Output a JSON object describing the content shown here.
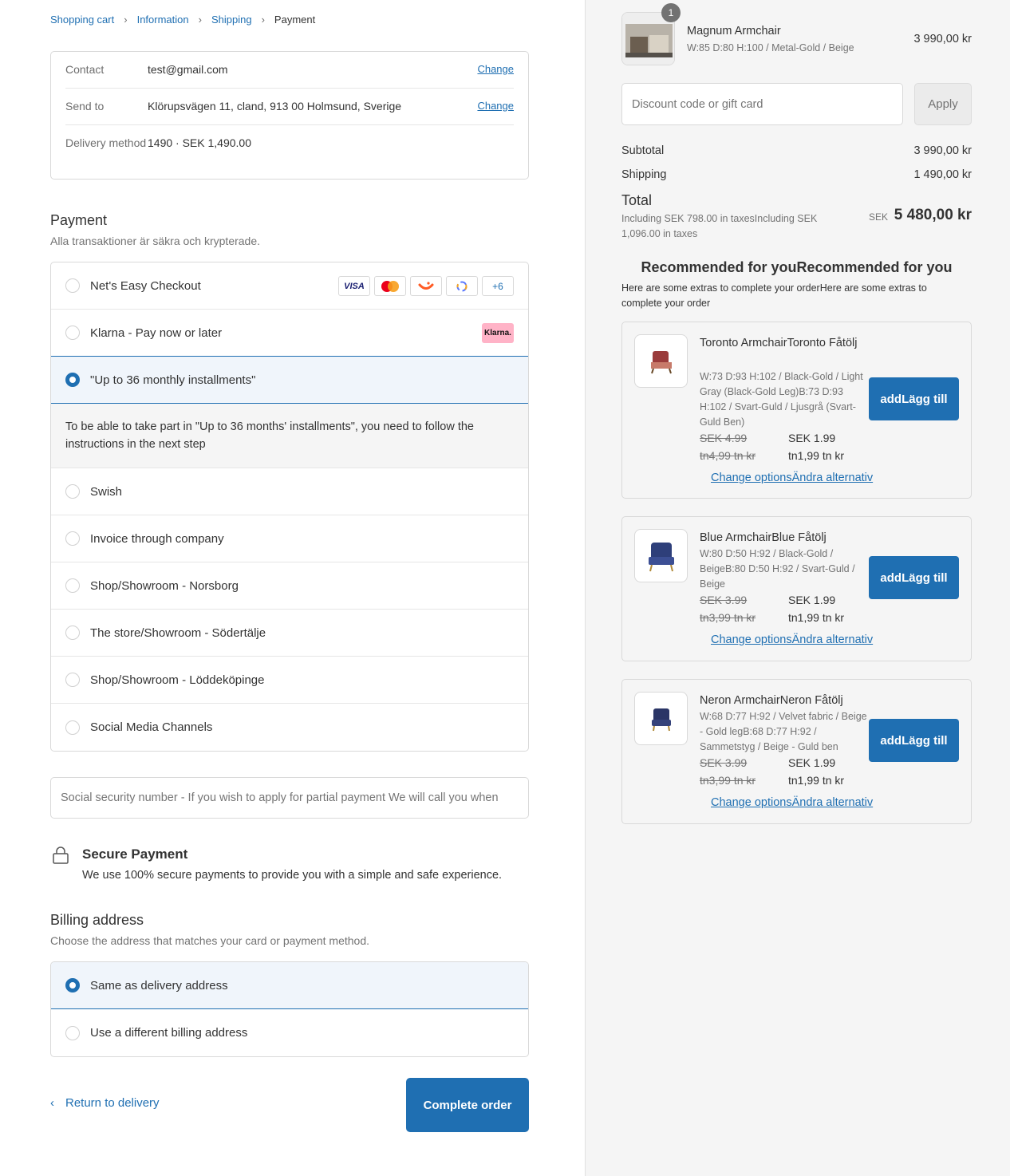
{
  "breadcrumb": {
    "cart": "Shopping cart",
    "information": "Information",
    "shipping": "Shipping",
    "payment": "Payment",
    "separator": "›"
  },
  "summary": {
    "contact_label": "Contact",
    "contact_value": "test@gmail.com",
    "sendto_label": "Send to",
    "sendto_value": "Klörupsvägen 11, cland, 913 00 Holmsund, Sverige",
    "delivery_label": "Delivery method",
    "delivery_value": "1490 · SEK 1,490.00",
    "change_label": "Change"
  },
  "payment": {
    "title": "Payment",
    "subtitle": "Alla transaktioner är säkra och krypterade.",
    "options": [
      "Net's Easy Checkout",
      "Klarna - Pay now or later",
      "\"Up to 36 monthly installments\"",
      "Swish",
      "Invoice through company",
      "Shop/Showroom - Norsborg",
      "The store/Showroom - Södertälje",
      "Shop/Showroom - Löddeköpinge",
      "Social Media Channels"
    ],
    "selected_index": 2,
    "installment_info": "To be able to take part in \"Up to 36 months' installments\", you need to follow the instructions in the next step",
    "cards": {
      "visa": "VISA",
      "more": "+6"
    },
    "klarna_badge": "Klarna."
  },
  "ssn": {
    "placeholder": "Social security number - If you wish to apply for partial payment We will call you when"
  },
  "secure": {
    "title": "Secure Payment",
    "text": "We use 100% secure payments to provide you with a simple and safe experience."
  },
  "billing": {
    "title": "Billing address",
    "subtitle": "Choose the address that matches your card or payment method.",
    "options": [
      "Same as delivery address",
      "Use a different billing address"
    ],
    "selected_index": 0
  },
  "footer": {
    "return_label": "Return to delivery",
    "complete_label": "Complete order"
  },
  "order": {
    "quantity": "1",
    "name": "Magnum Armchair",
    "variant": "W:85 D:80 H:100 / Metal-Gold / Beige",
    "price": "3 990,00 kr"
  },
  "discount": {
    "placeholder": "Discount code or gift card",
    "apply_label": "Apply"
  },
  "totals": {
    "subtotal_label": "Subtotal",
    "subtotal_value": "3 990,00 kr",
    "shipping_label": "Shipping",
    "shipping_value": "1 490,00 kr",
    "total_label": "Total",
    "tax_note": "Including SEK 798.00 in taxesIncluding SEK 1,096.00 in taxes",
    "currency": "SEK",
    "total_value": "5 480,00 kr"
  },
  "recommended": {
    "title": "Recommended for youRecommended for you",
    "subtitle": "Here are some extras to complete your orderHere are some extras to complete your order",
    "items": [
      {
        "name": "Toronto ArmchairToronto Fåtölj",
        "variant": "W:73 D:93 H:102 / Black-Gold / Light Gray (Black-Gold Leg)B:73 D:93 H:102 / Svart-Guld / Ljusgrå (Svart-Guld Ben)",
        "old_price": "SEK 4.99",
        "new_price": "SEK 1.99",
        "old_price2": "tn4,99 tn kr",
        "new_price2": "tn1,99 tn kr",
        "link": "Change optionsÄndra alternativ",
        "button": "addLägg till"
      },
      {
        "name": "Blue ArmchairBlue Fåtölj",
        "variant": "W:80 D:50 H:92 / Black-Gold / BeigeB:80 D:50 H:92 / Svart-Guld / Beige",
        "old_price": "SEK 3.99",
        "new_price": "SEK 1.99",
        "old_price2": "tn3,99 tn kr",
        "new_price2": "tn1,99 tn kr",
        "link": "Change optionsÄndra alternativ",
        "button": "addLägg till"
      },
      {
        "name": "Neron ArmchairNeron Fåtölj",
        "variant": "W:68 D:77 H:92 / Velvet fabric / Beige - Gold legB:68 D:77 H:92 / Sammetstyg / Beige - Guld ben",
        "old_price": "SEK 3.99",
        "new_price": "SEK 1.99",
        "old_price2": "tn3,99 tn kr",
        "new_price2": "tn1,99 tn kr",
        "link": "Change optionsÄndra alternativ",
        "button": "addLägg till"
      }
    ]
  }
}
